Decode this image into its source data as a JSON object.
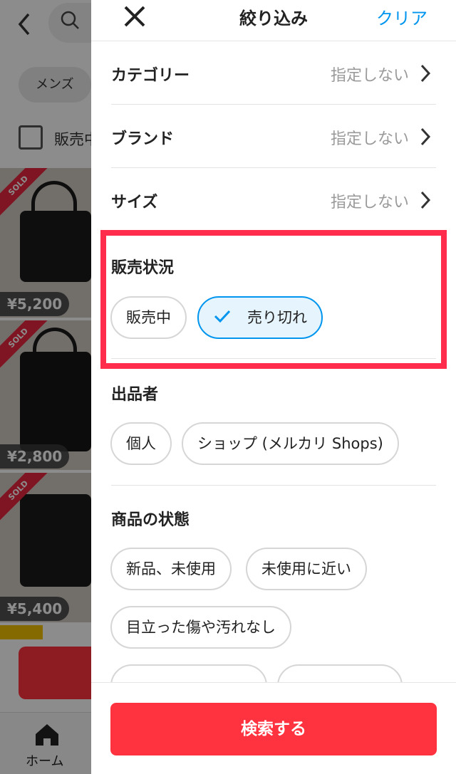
{
  "background": {
    "category_chip": "メンズ",
    "on_sale_checkbox_label": "販売中",
    "sold_badge": "SOLD",
    "listings": [
      {
        "price": "¥5,200"
      },
      {
        "price": "¥2,800"
      },
      {
        "price": "¥5,400"
      }
    ],
    "tabbar": {
      "home_label": "ホーム"
    }
  },
  "filter_panel": {
    "title": "絞り込み",
    "clear_label": "クリア",
    "rows": [
      {
        "label": "カテゴリー",
        "value": "指定しない"
      },
      {
        "label": "ブランド",
        "value": "指定しない"
      },
      {
        "label": "サイズ",
        "value": "指定しない"
      }
    ],
    "sales_status": {
      "title": "販売状況",
      "options": [
        {
          "label": "販売中",
          "selected": false
        },
        {
          "label": "売り切れ",
          "selected": true
        }
      ]
    },
    "seller": {
      "title": "出品者",
      "options": [
        "個人",
        "ショップ (メルカリ Shops)"
      ]
    },
    "condition": {
      "title": "商品の状態",
      "options": [
        "新品、未使用",
        "未使用に近い",
        "目立った傷や汚れなし"
      ]
    },
    "search_button": "検索する"
  },
  "colors": {
    "accent_blue": "#0095ee",
    "primary_red": "#ff333f",
    "highlight_red": "#ff2d4b"
  }
}
